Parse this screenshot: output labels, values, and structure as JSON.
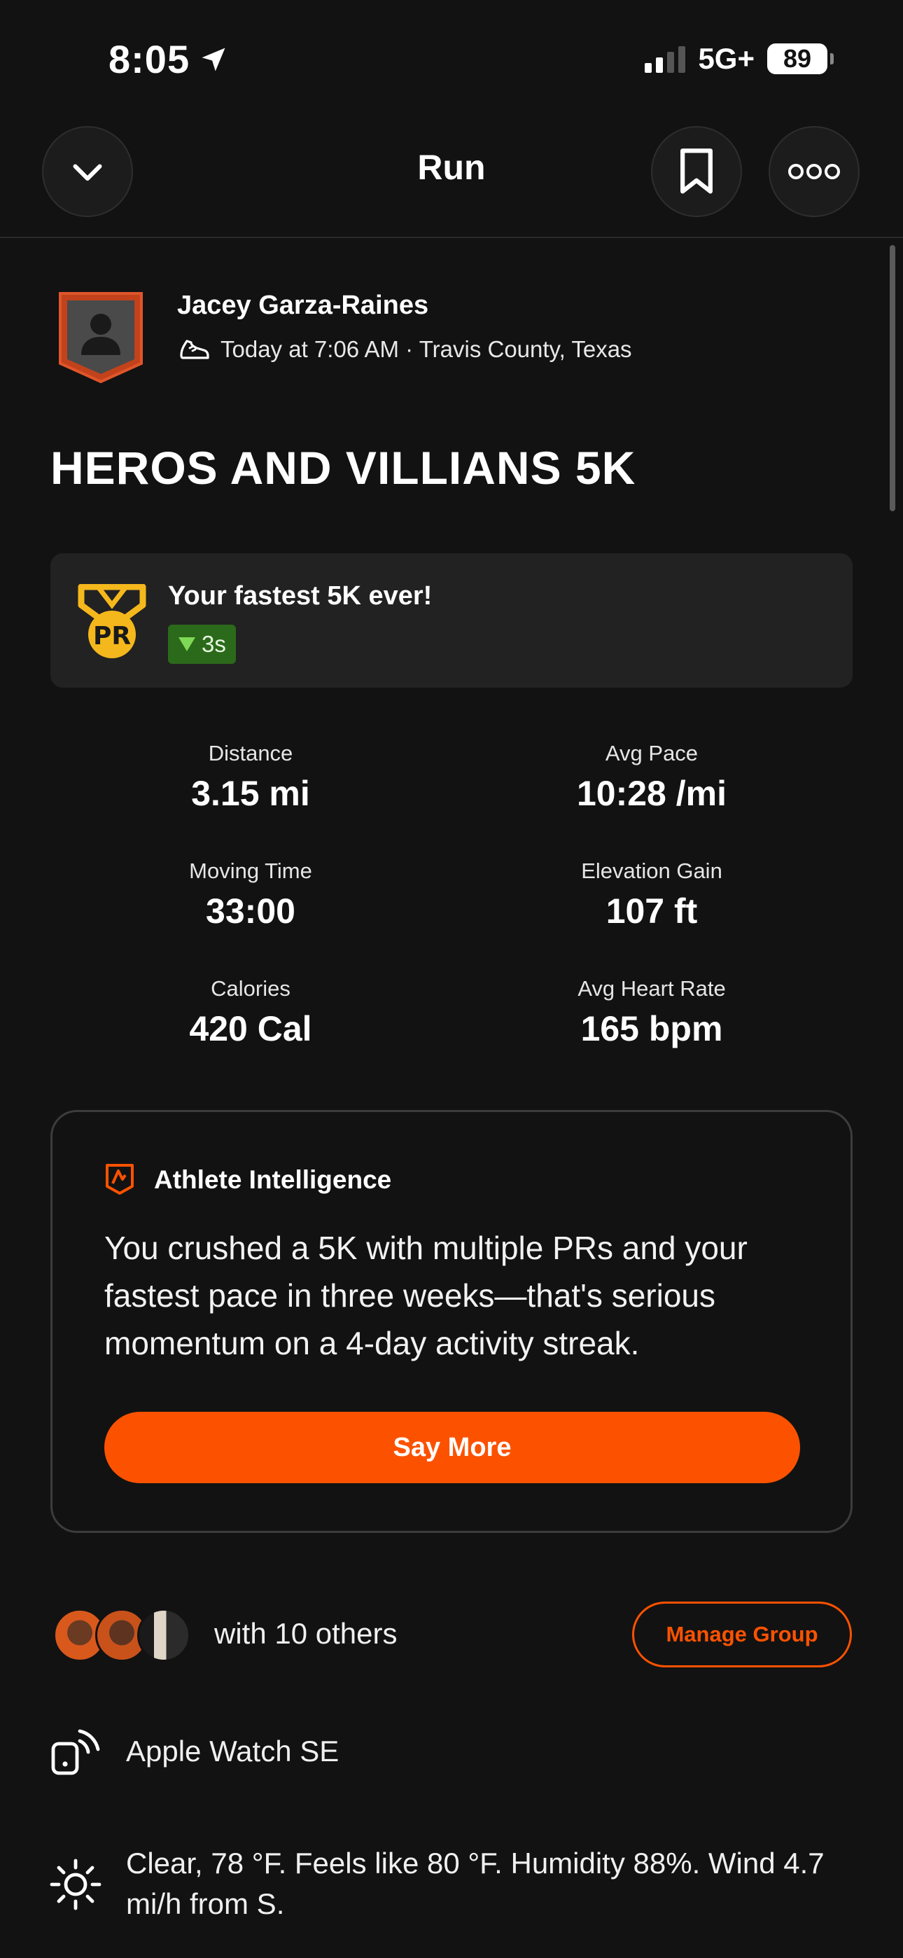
{
  "status_bar": {
    "time": "8:05",
    "network": "5G+",
    "battery": "89"
  },
  "nav": {
    "title": "Run"
  },
  "athlete": {
    "name": "Jacey Garza-Raines",
    "meta": "Today at 7:06 AM · Travis County, Texas"
  },
  "activity": {
    "title": "HEROS AND VILLIANS 5K"
  },
  "pr": {
    "message": "Your fastest 5K ever!",
    "improvement": "3s",
    "badge_text": "PR"
  },
  "stats": [
    {
      "label": "Distance",
      "value": "3.15 mi"
    },
    {
      "label": "Avg Pace",
      "value": "10:28 /mi"
    },
    {
      "label": "Moving Time",
      "value": "33:00"
    },
    {
      "label": "Elevation Gain",
      "value": "107 ft"
    },
    {
      "label": "Calories",
      "value": "420 Cal"
    },
    {
      "label": "Avg Heart Rate",
      "value": "165 bpm"
    }
  ],
  "athlete_intelligence": {
    "heading": "Athlete Intelligence",
    "summary": "You crushed a 5K with multiple PRs and your fastest pace in three weeks—that's serious momentum on a 4-day activity streak.",
    "button_label": "Say More"
  },
  "group": {
    "text": "with 10 others",
    "button_label": "Manage Group"
  },
  "device": {
    "name": "Apple Watch SE"
  },
  "weather": {
    "text": "Clear, 78 °F. Feels like 80 °F. Humidity 88%. Wind 4.7 mi/h from S."
  },
  "colors": {
    "background": "#121212",
    "accent": "#fc5200",
    "card": "#222222",
    "pr_gold": "#f5b81c",
    "pr_chip": "#2b6a1a"
  },
  "icons": [
    "location-arrow-icon",
    "chevron-down-icon",
    "bookmark-icon",
    "more-icon",
    "shoe-icon",
    "pr-medal-icon",
    "triangle-down-icon",
    "athlete-intelligence-icon",
    "device-icon",
    "sun-icon"
  ]
}
